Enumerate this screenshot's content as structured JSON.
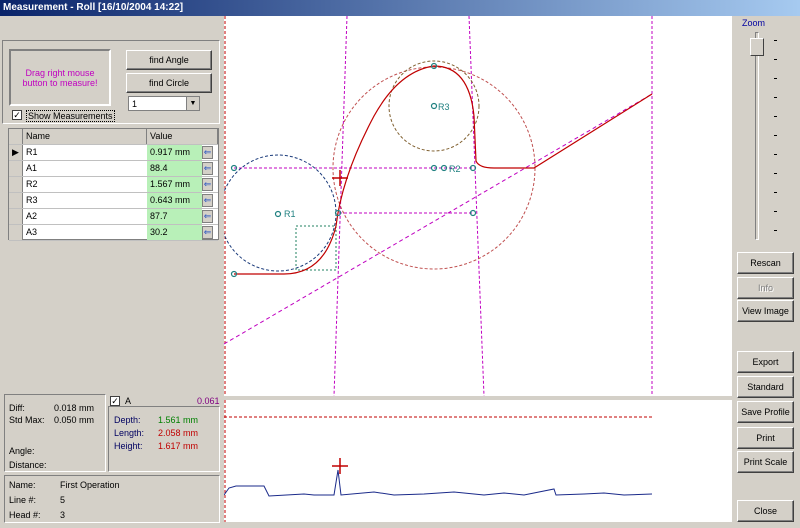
{
  "window": {
    "title": "Measurement  - Roll [16/10/2004 14:22]"
  },
  "left": {
    "drag_hint": "Drag right mouse button to measure!",
    "find_angle": "find Angle",
    "find_circle": "find Circle",
    "dropdown_value": "1",
    "show_measurements": "Show Measurements",
    "show_measurements_checked": true
  },
  "table": {
    "headers": [
      "Name",
      "Value"
    ],
    "rows": [
      {
        "name": "R1",
        "value": "0.917 mm"
      },
      {
        "name": "A1",
        "value": "88.4"
      },
      {
        "name": "R2",
        "value": "1.567 mm"
      },
      {
        "name": "R3",
        "value": "0.643 mm"
      },
      {
        "name": "A2",
        "value": "87.7"
      },
      {
        "name": "A3",
        "value": "30.2"
      }
    ]
  },
  "stats": {
    "diff_label": "Diff:",
    "diff_value": "0.018 mm",
    "stdmax_label": "Std Max:",
    "stdmax_value": "0.050 mm",
    "angle_label": "Angle:",
    "distance_label": "Distance:",
    "a_label": "A",
    "a_value": "0.061",
    "depth_label": "Depth:",
    "depth_value": "1.561 mm",
    "length_label": "Length:",
    "length_value": "2.058 mm",
    "height_label": "Height:",
    "height_value": "1.617 mm",
    "colors": {
      "depth": "#008000",
      "length": "#c00000",
      "height": "#c00000",
      "a_value": "#800080"
    }
  },
  "info": {
    "name_label": "Name:",
    "name_value": "First Operation",
    "line_label": "Line #:",
    "line_value": "5",
    "head_label": "Head #:",
    "head_value": "3"
  },
  "view": {
    "labels": [
      "R1",
      "R2",
      "R3"
    ]
  },
  "zoom": {
    "label": "Zoom"
  },
  "buttons": {
    "rescan": "Rescan",
    "info": "Info",
    "view_image": "View Image",
    "export": "Export",
    "standard": "Standard",
    "save_profile": "Save Profile",
    "print": "Print",
    "print_scale": "Print Scale",
    "close": "Close"
  }
}
